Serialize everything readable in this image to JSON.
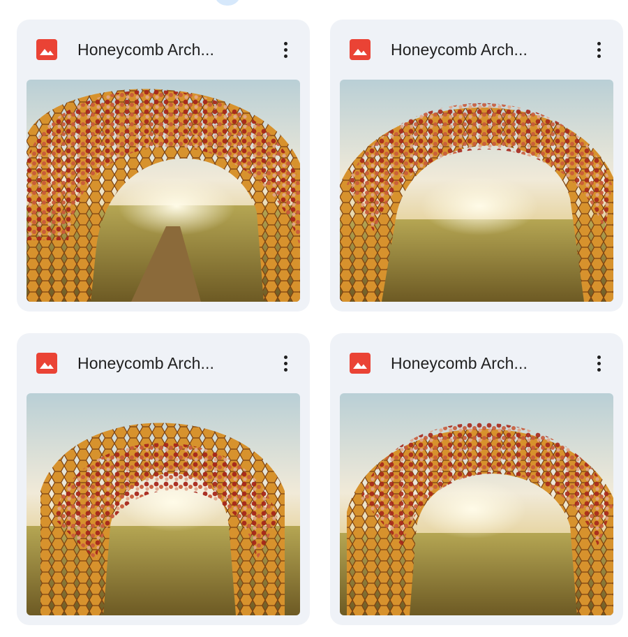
{
  "files": [
    {
      "title": "Honeycomb Arch...",
      "file_type_icon": "image-file-icon",
      "icon_color": "#ea4335"
    },
    {
      "title": "Honeycomb Arch...",
      "file_type_icon": "image-file-icon",
      "icon_color": "#ea4335"
    },
    {
      "title": "Honeycomb Arch...",
      "file_type_icon": "image-file-icon",
      "icon_color": "#ea4335"
    },
    {
      "title": "Honeycomb Arch...",
      "file_type_icon": "image-file-icon",
      "icon_color": "#ea4335"
    }
  ],
  "more_actions_icon": "more-vert-icon"
}
